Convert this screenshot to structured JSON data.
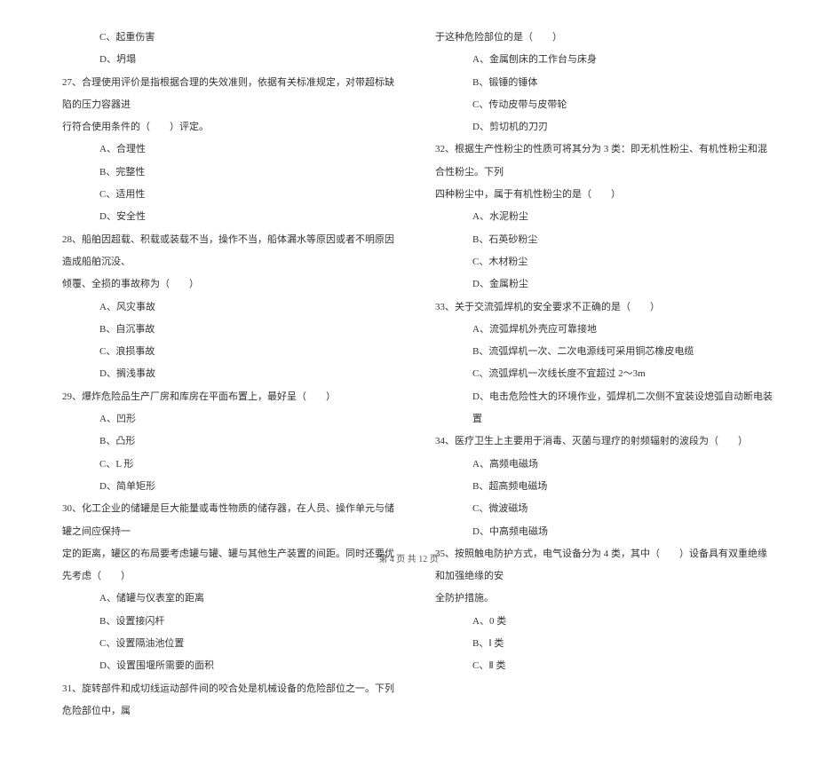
{
  "leftCol": {
    "preOpts": [
      "C、起重伤害",
      "D、坍塌"
    ],
    "q27": {
      "stem1": "27、合理使用评价是指根据合理的失效准则，依据有关标准规定，对带超标缺陷的压力容器进",
      "stem2": "行符合使用条件的（　　）评定。",
      "opts": [
        "A、合理性",
        "B、完整性",
        "C、适用性",
        "D、安全性"
      ]
    },
    "q28": {
      "stem1": "28、船舶因超载、积载或装载不当，操作不当，船体漏水等原因或者不明原因造成船舶沉没、",
      "stem2": "倾覆、全损的事故称为（　　）",
      "opts": [
        "A、风灾事故",
        "B、自沉事故",
        "C、浪损事故",
        "D、搁浅事故"
      ]
    },
    "q29": {
      "stem": "29、爆炸危险品生产厂房和库房在平面布置上，最好呈（　　）",
      "opts": [
        "A、凹形",
        "B、凸形",
        "C、L 形",
        "D、简单矩形"
      ]
    },
    "q30": {
      "stem1": "30、化工企业的储罐是巨大能量或毒性物质的储存器，在人员、操作单元与储罐之间应保持一",
      "stem2": "定的距离，罐区的布局要考虑罐与罐、罐与其他生产装置的间距。同时还要优先考虑（　　）",
      "opts": [
        "A、储罐与仪表室的距离",
        "B、设置接闪杆",
        "C、设置隔油池位置",
        "D、设置围堰所需要的面积"
      ]
    },
    "q31": {
      "stem": "31、旋转部件和成切线运动部件间的咬合处是机械设备的危险部位之一。下列危险部位中，属"
    }
  },
  "rightCol": {
    "q31cont": {
      "stem": "于这种危险部位的是（　　）",
      "opts": [
        "A、金属刨床的工作台与床身",
        "B、锻锤的锤体",
        "C、传动皮带与皮带轮",
        "D、剪切机的刀刃"
      ]
    },
    "q32": {
      "stem1": "32、根据生产性粉尘的性质可将其分为 3 类：即无机性粉尘、有机性粉尘和混合性粉尘。下列",
      "stem2": "四种粉尘中，属于有机性粉尘的是（　　）",
      "opts": [
        "A、水泥粉尘",
        "B、石英砂粉尘",
        "C、木材粉尘",
        "D、金属粉尘"
      ]
    },
    "q33": {
      "stem": "33、关于交流弧焊机的安全要求不正确的是（　　）",
      "opts": [
        "A、流弧焊机外壳应可靠接地",
        "B、流弧焊机一次、二次电源线可采用铜芯橡皮电缆",
        "C、流弧焊机一次线长度不宜超过 2～3m",
        "D、电击危险性大的环境作业，弧焊机二次侧不宜装设熄弧自动断电装置"
      ]
    },
    "q34": {
      "stem": "34、医疗卫生上主要用于消毒、灭菌与理疗的射频辐射的波段为（　　）",
      "opts": [
        "A、高频电磁场",
        "B、超高频电磁场",
        "C、微波磁场",
        "D、中高频电磁场"
      ]
    },
    "q35": {
      "stem1": "35、按照触电防护方式，电气设备分为 4 类，其中（　　）设备具有双重绝缘和加强绝缘的安",
      "stem2": "全防护措施。",
      "opts": [
        "A、0 类",
        "B、Ⅰ 类",
        "C、Ⅱ 类"
      ]
    }
  },
  "footer": "第 4 页 共 12 页"
}
